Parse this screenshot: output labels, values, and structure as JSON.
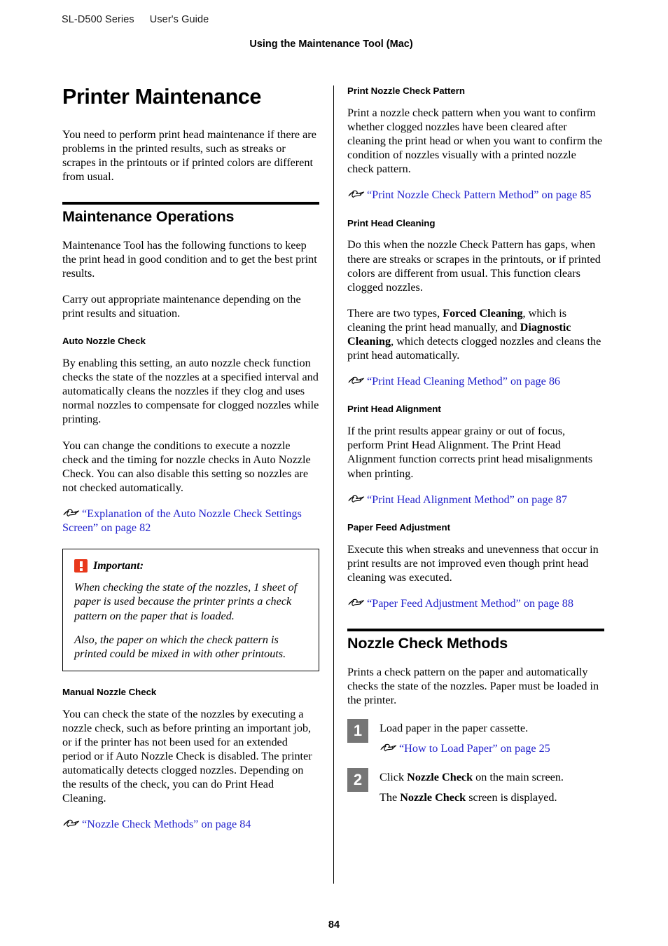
{
  "header": {
    "series": "SL-D500 Series",
    "guide": "User's Guide",
    "chapter": "Using the Maintenance Tool (Mac)"
  },
  "footer": {
    "page_number": "84"
  },
  "colors": {
    "link": "#2222CC",
    "important_icon": "#E8381B",
    "step_box": "#767676",
    "rule": "#000000"
  },
  "icons": {
    "xref": "pointing-hand-icon",
    "important": "important-exclamation-icon"
  },
  "left_column": {
    "title": "Printer Maintenance",
    "intro": "You need to perform print head maintenance if there are problems in the printed results, such as streaks or scrapes in the printouts or if printed colors are different from usual.",
    "section": {
      "heading": "Maintenance Operations",
      "para1": "Maintenance Tool has the following functions to keep the print head in good condition and to get the best print results.",
      "para2": "Carry out appropriate maintenance depending on the print results and situation."
    },
    "auto_nozzle_check": {
      "heading": "Auto Nozzle Check",
      "para1": "By enabling this setting, an auto nozzle check function checks the state of the nozzles at a specified interval and automatically cleans the nozzles if they clog and uses normal nozzles to compensate for clogged nozzles while printing.",
      "para2": "You can change the conditions to execute a nozzle check and the timing for nozzle checks in Auto Nozzle Check. You can also disable this setting so nozzles are not checked automatically.",
      "link": "“Explanation of the Auto Nozzle Check Settings Screen” on page 82"
    },
    "important": {
      "title": "Important:",
      "para1": "When checking the state of the nozzles, 1 sheet of paper is used because the printer prints a check pattern on the paper that is loaded.",
      "para2": "Also, the paper on which the check pattern is printed could be mixed in with other printouts."
    },
    "manual_nozzle_check": {
      "heading": "Manual Nozzle Check",
      "para1": "You can check the state of the nozzles by executing a nozzle check, such as before printing an important job, or if the printer has not been used for an extended period or if Auto Nozzle Check is disabled. The printer automatically detects clogged nozzles. Depending on the results of the check, you can do Print Head Cleaning.",
      "link": "“Nozzle Check Methods” on page 84"
    }
  },
  "right_column": {
    "print_nozzle_check_pattern": {
      "heading": "Print Nozzle Check Pattern",
      "para1": "Print a nozzle check pattern when you want to confirm whether clogged nozzles have been cleared after cleaning the print head or when you want to confirm the condition of nozzles visually with a printed nozzle check pattern.",
      "link": "“Print Nozzle Check Pattern Method” on page 85"
    },
    "print_head_cleaning": {
      "heading": "Print Head Cleaning",
      "para1": "Do this when the nozzle Check Pattern has gaps, when there are streaks or scrapes in the printouts, or if printed colors are different from usual. This function clears clogged nozzles.",
      "para2_a": "There are two types, ",
      "para2_b": "Forced Cleaning",
      "para2_c": ", which is cleaning the print head manually, and ",
      "para2_d": "Diagnostic Cleaning",
      "para2_e": ", which detects clogged nozzles and cleans the print head automatically.",
      "link": "“Print Head Cleaning Method” on page 86"
    },
    "print_head_alignment": {
      "heading": "Print Head Alignment",
      "para1": "If the print results appear grainy or out of focus, perform Print Head Alignment. The Print Head Alignment function corrects print head misalignments when printing.",
      "link": "“Print Head Alignment Method” on page 87"
    },
    "paper_feed_adjustment": {
      "heading": "Paper Feed Adjustment",
      "para1": "Execute this when streaks and unevenness that occur in print results are not improved even though print head cleaning was executed.",
      "link": "“Paper Feed Adjustment Method” on page 88"
    },
    "nozzle_check_methods": {
      "heading": "Nozzle Check Methods",
      "intro": "Prints a check pattern on the paper and automatically checks the state of the nozzles. Paper must be loaded in the printer.",
      "steps": [
        {
          "number": "1",
          "text": "Load paper in the paper cassette.",
          "link": "“How to Load Paper” on page 25"
        },
        {
          "number": "2",
          "text_a": "Click ",
          "text_b": "Nozzle Check",
          "text_c": " on the main screen.",
          "text2_a": "The ",
          "text2_b": "Nozzle Check",
          "text2_c": " screen is displayed."
        }
      ]
    }
  }
}
